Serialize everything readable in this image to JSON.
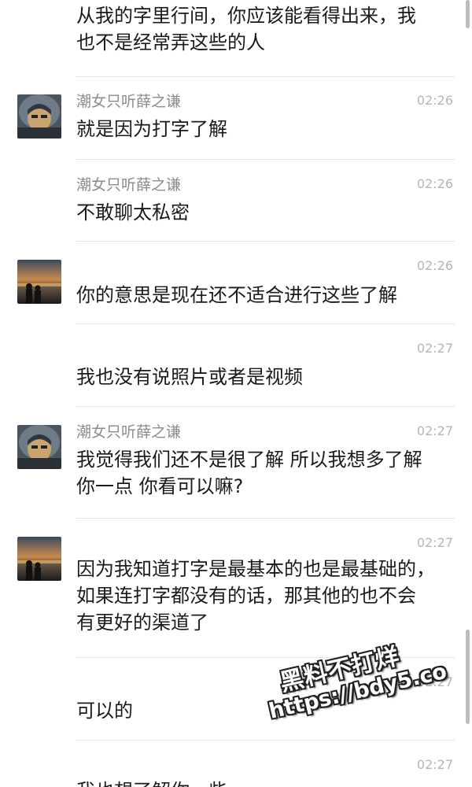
{
  "messages": [
    {
      "lines": [
        "从我的字里行间，你应该能看得出来，我",
        "也不是经常弄这些的人"
      ]
    },
    {
      "sender": "潮女只听薛之谦",
      "avatar": "girl-hood-avatar",
      "time": "02:26",
      "lines": [
        "就是因为打字了解"
      ]
    },
    {
      "sender": "潮女只听薛之谦",
      "time": "02:26",
      "lines": [
        "不敢聊太私密"
      ]
    },
    {
      "avatar": "sunset-couple-avatar",
      "time": "02:26",
      "lines": [
        "你的意思是现在还不适合进行这些了解"
      ]
    },
    {
      "time": "02:27",
      "lines": [
        "我也没有说照片或者是视频"
      ]
    },
    {
      "sender": "潮女只听薛之谦",
      "avatar": "girl-hood-avatar",
      "time": "02:27",
      "lines": [
        "我觉得我们还不是很了解 所以我想多了解",
        "你一点 你看可以嘛?"
      ]
    },
    {
      "avatar": "sunset-couple-avatar",
      "time": "02:27",
      "lines": [
        "因为我知道打字是最基本的也是最基础的，",
        "如果连打字都没有的话，那其他的也不会",
        "有更好的渠道了"
      ]
    },
    {
      "time": "02:27",
      "lines": [
        "可以的"
      ]
    },
    {
      "time": "02:27",
      "lines": [
        "我也想了解你一些"
      ]
    }
  ],
  "watermark": {
    "line1": "黑料不打烊",
    "line2": "https://bdy5.co"
  }
}
